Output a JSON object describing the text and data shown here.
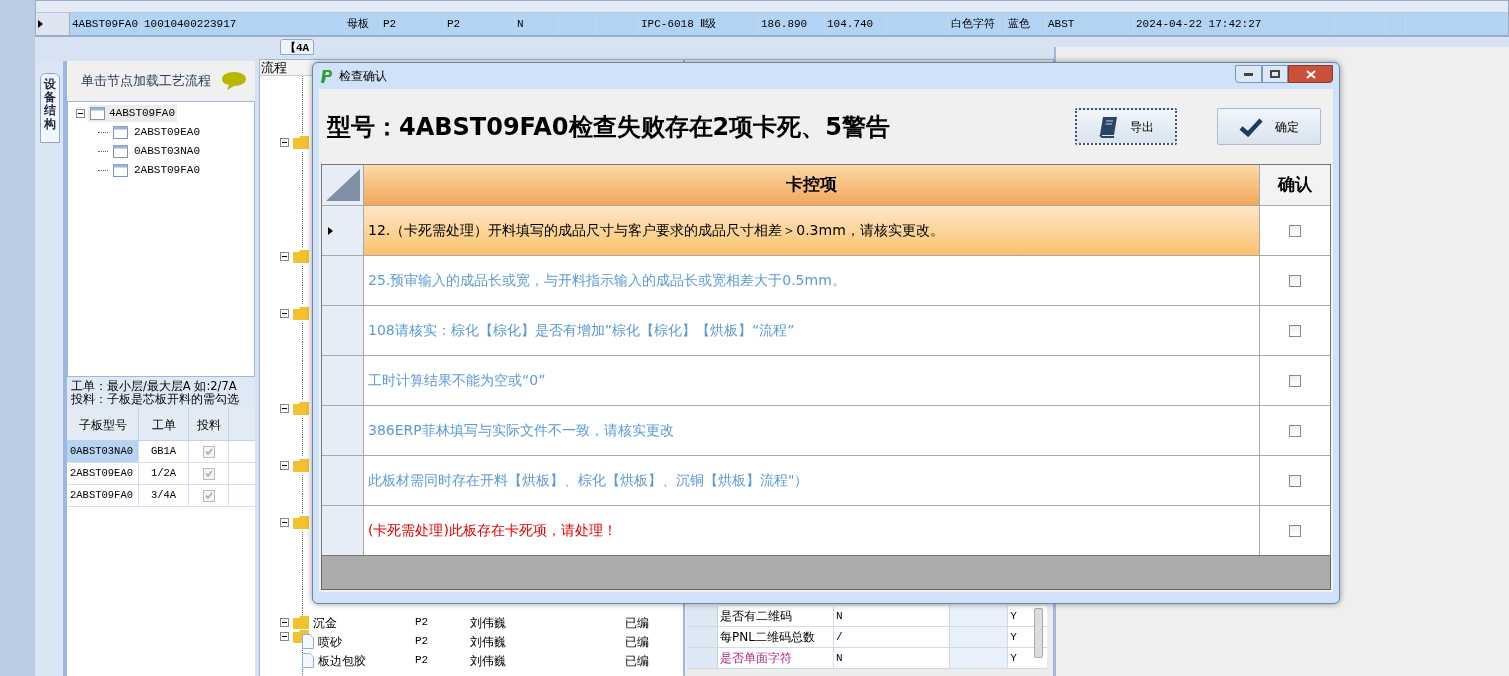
{
  "top_grid": {
    "rows": [
      {
        "selected": true,
        "cells": [
          "4ABST09FA0",
          "10010400223917",
          "",
          "母板",
          "P2",
          "P2",
          "N",
          "",
          "",
          "IPC-6018 Ⅱ级",
          "186.890",
          "104.740",
          "",
          "白色字符",
          "蓝色",
          "ABST",
          "2024-04-22 17:42:27",
          "",
          ""
        ]
      }
    ]
  },
  "doc_tab": {
    "label": "【4A"
  },
  "left_panel": {
    "side_tab": "设备结构",
    "header": "单击节点加载工艺流程",
    "tree": [
      {
        "label": "4ABST09FA0",
        "expanded": true,
        "selected": true,
        "children": [
          {
            "label": "2ABST09EA0",
            "selected": false
          },
          {
            "label": "0ABST03NA0",
            "selected": false
          },
          {
            "label": "2ABST09FA0",
            "selected": false
          }
        ]
      }
    ],
    "note_lines": [
      "工单：最小层/最大层A 如:2/7A",
      "投料：子板是芯板开料的需勾选"
    ],
    "sub_grid": {
      "columns": [
        "子板型号",
        "工单",
        "投料"
      ],
      "rows": [
        {
          "board": "0ABST03NA0",
          "order": "GB1A",
          "feed": true,
          "selected": true
        },
        {
          "board": "2ABST09EA0",
          "order": "1/2A",
          "feed": true,
          "selected": false
        },
        {
          "board": "2ABST09FA0",
          "order": "3/4A",
          "feed": true,
          "selected": false
        }
      ]
    }
  },
  "process_tree": {
    "header": "流程",
    "rows": [
      {
        "kind": "folder",
        "name": "沉金",
        "code": "P2",
        "person": "刘伟巍",
        "status": "已编"
      },
      {
        "kind": "step",
        "name": "喷砂",
        "code": "P2",
        "person": "刘伟巍",
        "status": "已编"
      },
      {
        "kind": "step",
        "name": "板边包胶",
        "code": "P2",
        "person": "刘伟巍",
        "status": "已编"
      }
    ]
  },
  "param_grid": {
    "rows": [
      {
        "name": "是否有二维码",
        "value": "N",
        "flag": "Y",
        "highlight": false
      },
      {
        "name": "每PNL二维码总数",
        "value": "/",
        "flag": "Y",
        "highlight": false
      },
      {
        "name": "是否单面字符",
        "value": "N",
        "flag": "Y",
        "highlight": true
      }
    ]
  },
  "dialog": {
    "title": "检查确认",
    "heading": "型号：4ABST09FA0检查失败存在2项卡死、5警告",
    "buttons": [
      {
        "kind": "export",
        "label": "导出"
      },
      {
        "kind": "ok",
        "label": "确定"
      }
    ],
    "columns": [
      "卡控项",
      "确认"
    ],
    "items": [
      {
        "text": "12.（卡死需处理）开料填写的成品尺寸与客户要求的成品尺寸相差＞0.3mm，请核实更改。",
        "kind": "block",
        "selected": true,
        "checked": false
      },
      {
        "text": "25.预审输入的成品长或宽，与开料指示输入的成品长或宽相差大于0.5mm。",
        "kind": "warn",
        "selected": false,
        "checked": false
      },
      {
        "text": "108请核实：棕化【棕化】是否有增加”棕化【棕化】【烘板】“流程”",
        "kind": "warn",
        "selected": false,
        "checked": false
      },
      {
        "text": "工时计算结果不能为空或“0”",
        "kind": "warn",
        "selected": false,
        "checked": false
      },
      {
        "text": "386ERP菲林填写与实际文件不一致，请核实更改",
        "kind": "warn",
        "selected": false,
        "checked": false
      },
      {
        "text": "此板材需同时存在开料【烘板】、棕化【烘板】、沉铜【烘板】流程\"）",
        "kind": "warn",
        "selected": false,
        "checked": false
      },
      {
        "text": "(卡死需处理)此板存在卡死项，请处理！",
        "kind": "block",
        "selected": false,
        "checked": false
      }
    ]
  }
}
